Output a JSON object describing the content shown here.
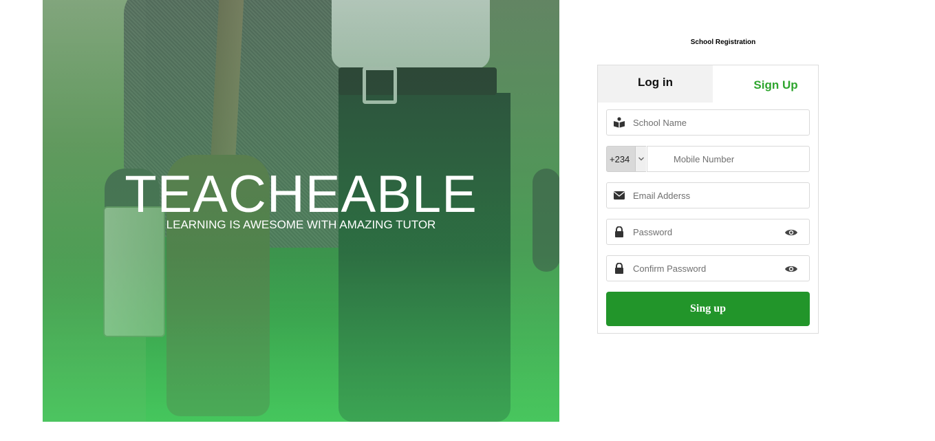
{
  "hero": {
    "title": "TEACHEABLE",
    "tagline": "LEARNING IS AWESOME WITH AMAZING TUTOR"
  },
  "page_label": "School Registration",
  "tabs": {
    "login": "Log in",
    "signup": "Sign Up"
  },
  "form": {
    "school_name_placeholder": "School Name",
    "country_code": "+234",
    "mobile_placeholder": "Mobile Number",
    "email_placeholder": "Email Adderss",
    "password_placeholder": "Password",
    "confirm_password_placeholder": "Confirm Password",
    "submit_label": "Sing up"
  },
  "colors": {
    "accent": "#22952a",
    "signup_tab_text": "#2ea52e",
    "login_tab_bg": "#f2f2f2"
  },
  "icons": {
    "school": "book-reader-icon",
    "email": "envelope-icon",
    "password": "lock-icon",
    "reveal": "eye-icon",
    "dropdown": "chevron-down-icon"
  }
}
